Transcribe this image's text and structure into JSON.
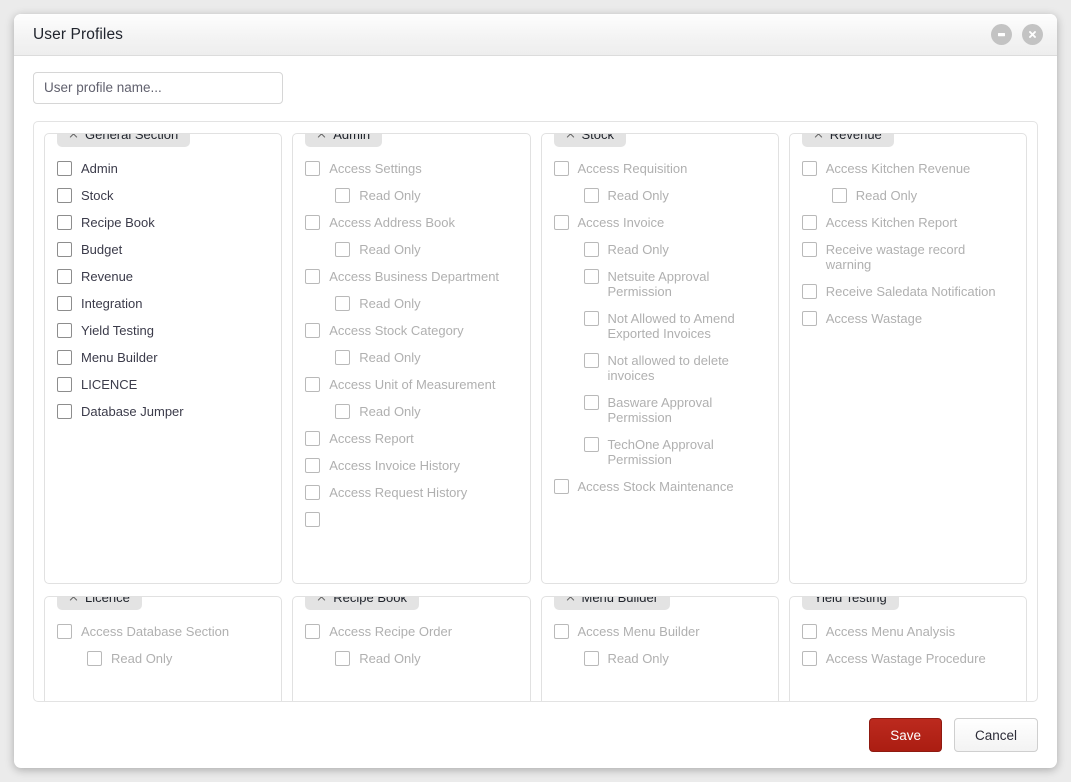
{
  "window": {
    "title": "User Profiles",
    "minimize_icon": "minimize-icon",
    "close_icon": "close-icon"
  },
  "profile_name": {
    "value": "",
    "placeholder": "User profile name..."
  },
  "footer": {
    "save_label": "Save",
    "cancel_label": "Cancel",
    "save_color": "#ab1d12"
  },
  "panels": [
    {
      "title": "General Section",
      "collapsible": true,
      "disabled": false,
      "options": [
        {
          "label": "Admin",
          "sub": false,
          "checked": false
        },
        {
          "label": "Stock",
          "sub": false,
          "checked": false
        },
        {
          "label": "Recipe Book",
          "sub": false,
          "checked": false
        },
        {
          "label": "Budget",
          "sub": false,
          "checked": false
        },
        {
          "label": "Revenue",
          "sub": false,
          "checked": false
        },
        {
          "label": "Integration",
          "sub": false,
          "checked": false
        },
        {
          "label": "Yield Testing",
          "sub": false,
          "checked": false
        },
        {
          "label": "Menu Builder",
          "sub": false,
          "checked": false
        },
        {
          "label": "LICENCE",
          "sub": false,
          "checked": false
        },
        {
          "label": "Database Jumper",
          "sub": false,
          "checked": false
        }
      ]
    },
    {
      "title": "Admin",
      "collapsible": true,
      "disabled": true,
      "options": [
        {
          "label": "Access Settings",
          "sub": false,
          "checked": false
        },
        {
          "label": "Read Only",
          "sub": true,
          "checked": false
        },
        {
          "label": "Access Address Book",
          "sub": false,
          "checked": false
        },
        {
          "label": "Read Only",
          "sub": true,
          "checked": false
        },
        {
          "label": "Access Business Department",
          "sub": false,
          "checked": false
        },
        {
          "label": "Read Only",
          "sub": true,
          "checked": false
        },
        {
          "label": "Access Stock Category",
          "sub": false,
          "checked": false
        },
        {
          "label": "Read Only",
          "sub": true,
          "checked": false
        },
        {
          "label": "Access Unit of Measurement",
          "sub": false,
          "checked": false
        },
        {
          "label": "Read Only",
          "sub": true,
          "checked": false
        },
        {
          "label": "Access Report",
          "sub": false,
          "checked": false
        },
        {
          "label": "Access Invoice History",
          "sub": false,
          "checked": false
        },
        {
          "label": "Access Request History",
          "sub": false,
          "checked": false
        },
        {
          "label": "",
          "sub": false,
          "checked": false
        }
      ]
    },
    {
      "title": "Stock",
      "collapsible": true,
      "disabled": true,
      "options": [
        {
          "label": "Access Requisition",
          "sub": false,
          "checked": false
        },
        {
          "label": "Read Only",
          "sub": true,
          "checked": false
        },
        {
          "label": "Access Invoice",
          "sub": false,
          "checked": false
        },
        {
          "label": "Read Only",
          "sub": true,
          "checked": false
        },
        {
          "label": "Netsuite Approval Permission",
          "sub": true,
          "checked": false
        },
        {
          "label": "Not Allowed to Amend Exported Invoices",
          "sub": true,
          "checked": false
        },
        {
          "label": "Not allowed to delete invoices",
          "sub": true,
          "checked": false
        },
        {
          "label": "Basware Approval Permission",
          "sub": true,
          "checked": false
        },
        {
          "label": "TechOne Approval Permission",
          "sub": true,
          "checked": false
        },
        {
          "label": "Access Stock Maintenance",
          "sub": false,
          "checked": false
        }
      ]
    },
    {
      "title": "Revenue",
      "collapsible": true,
      "disabled": true,
      "options": [
        {
          "label": "Access Kitchen Revenue",
          "sub": false,
          "checked": false
        },
        {
          "label": "Read Only",
          "sub": true,
          "checked": false
        },
        {
          "label": "Access Kitchen Report",
          "sub": false,
          "checked": false
        },
        {
          "label": "Receive wastage record warning",
          "sub": false,
          "checked": false
        },
        {
          "label": "Receive Saledata Notification",
          "sub": false,
          "checked": false
        },
        {
          "label": "Access Wastage",
          "sub": false,
          "checked": false
        }
      ]
    },
    {
      "title": "Licence",
      "collapsible": true,
      "disabled": true,
      "options": [
        {
          "label": "Access Database Section",
          "sub": false,
          "checked": false
        },
        {
          "label": "Read Only",
          "sub": true,
          "checked": false
        }
      ]
    },
    {
      "title": "Recipe Book",
      "collapsible": true,
      "disabled": true,
      "options": [
        {
          "label": "Access Recipe Order",
          "sub": false,
          "checked": false
        },
        {
          "label": "Read Only",
          "sub": true,
          "checked": false
        }
      ]
    },
    {
      "title": "Menu Builder",
      "collapsible": true,
      "disabled": true,
      "options": [
        {
          "label": "Access Menu Builder",
          "sub": false,
          "checked": false
        },
        {
          "label": "Read Only",
          "sub": true,
          "checked": false
        }
      ]
    },
    {
      "title": "Yield Testing",
      "collapsible": false,
      "disabled": true,
      "options": [
        {
          "label": "Access Menu Analysis",
          "sub": false,
          "checked": false
        },
        {
          "label": "Access Wastage Procedure",
          "sub": false,
          "checked": false
        }
      ]
    }
  ]
}
